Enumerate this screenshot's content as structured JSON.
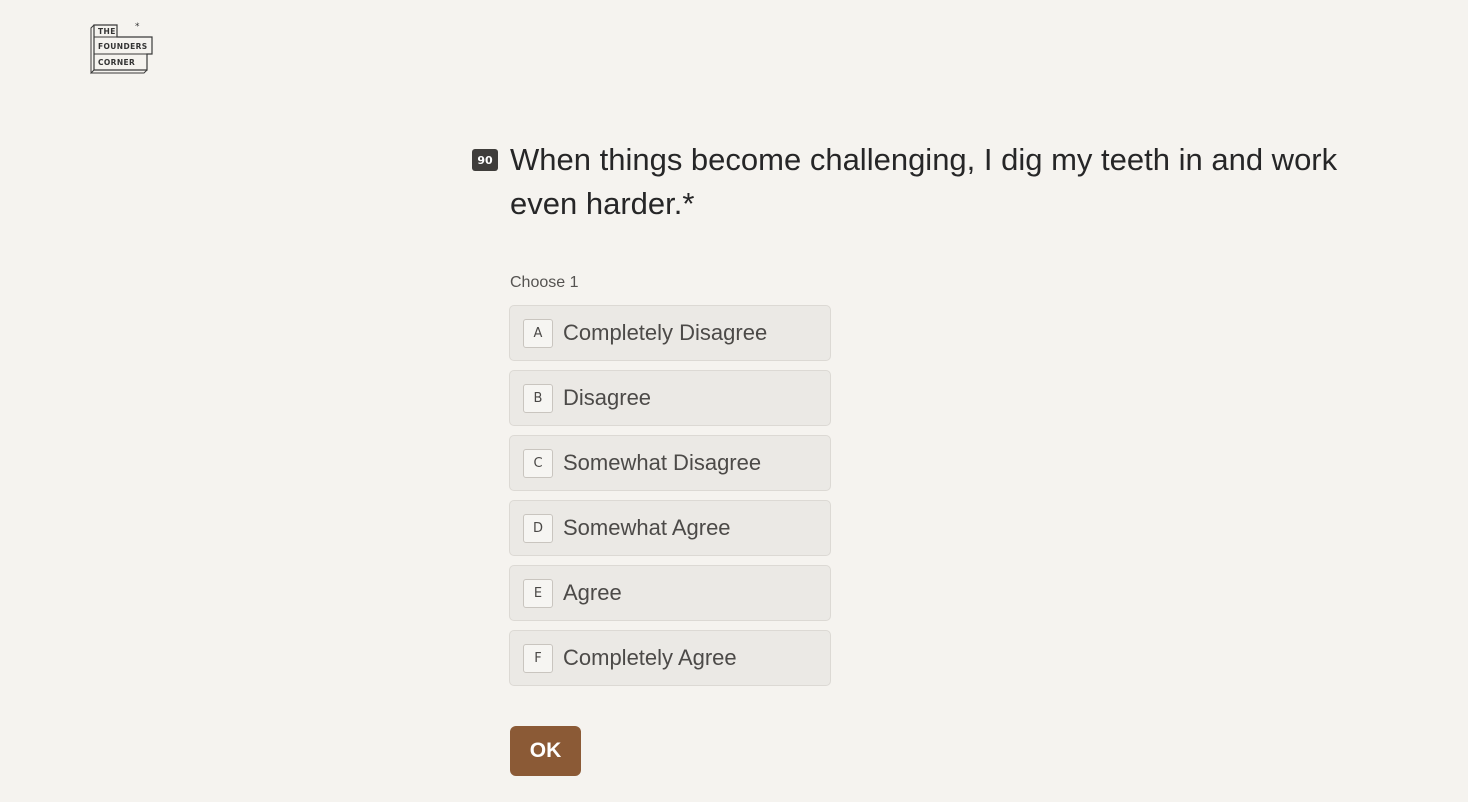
{
  "logo": {
    "line1": "THE",
    "line2": "FOUNDERS",
    "line3": "CORNER",
    "mark": "*"
  },
  "question": {
    "number": "90",
    "title": "When things become challenging, I dig my teeth in and work even harder.*"
  },
  "hint": "Choose 1",
  "options": [
    {
      "key": "A",
      "label": "Completely Disagree"
    },
    {
      "key": "B",
      "label": "Disagree"
    },
    {
      "key": "C",
      "label": "Somewhat Disagree"
    },
    {
      "key": "D",
      "label": "Somewhat Agree"
    },
    {
      "key": "E",
      "label": "Agree"
    },
    {
      "key": "F",
      "label": "Completely Agree"
    }
  ],
  "ok_button": {
    "label": "OK"
  },
  "colors": {
    "background": "#f5f3ef",
    "accent": "#8b5a36",
    "option_bg": "#ebe9e5",
    "text": "#262627"
  }
}
